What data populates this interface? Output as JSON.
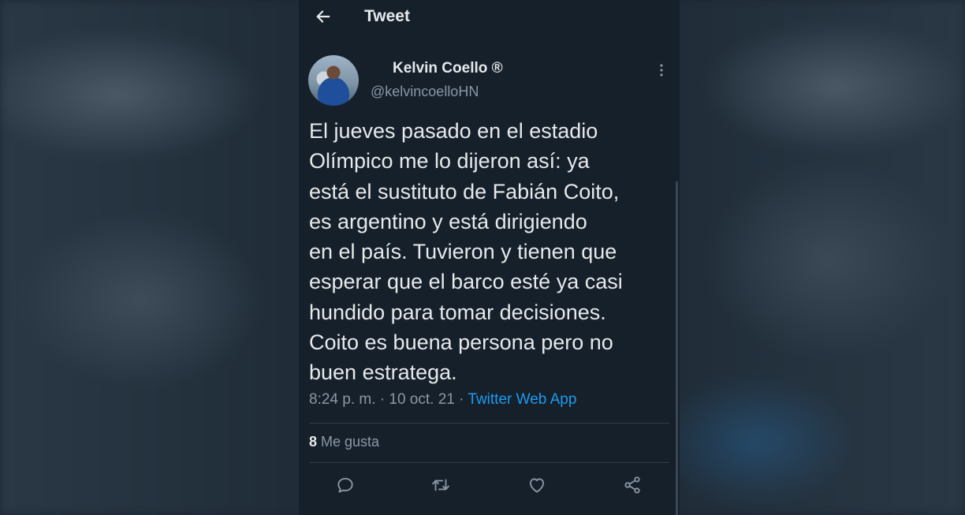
{
  "header": {
    "title": "Tweet",
    "back_icon": "arrow-left-icon"
  },
  "author": {
    "display_name": "Kelvin Coello ®",
    "handle": "@kelvincoelloHN",
    "avatar": "user-avatar"
  },
  "tweet": {
    "text": "El jueves pasado en el estadio\nOlímpico me lo dijeron así: ya\nestá el sustituto de Fabián Coito,\nes argentino y está dirigiendo\nen el país. Tuvieron y tienen que\nesperar que el barco esté ya casi\nhundido para tomar decisiones.\nCoito es buena persona pero no\nbuen estratega.",
    "time": "8:24 p. m.",
    "separator": " · ",
    "date": "10 oct. 21",
    "source": "Twitter Web App"
  },
  "stats": {
    "likes_count": "8",
    "likes_label": " Me gusta"
  },
  "actions": [
    "reply-icon",
    "retweet-icon",
    "like-icon",
    "share-icon"
  ],
  "colors": {
    "panel_background": "#15202b",
    "text_primary": "#e7e9ea",
    "text_secondary": "#8b98a5",
    "link": "#1d9bf0",
    "divider": "#2f3b48"
  }
}
